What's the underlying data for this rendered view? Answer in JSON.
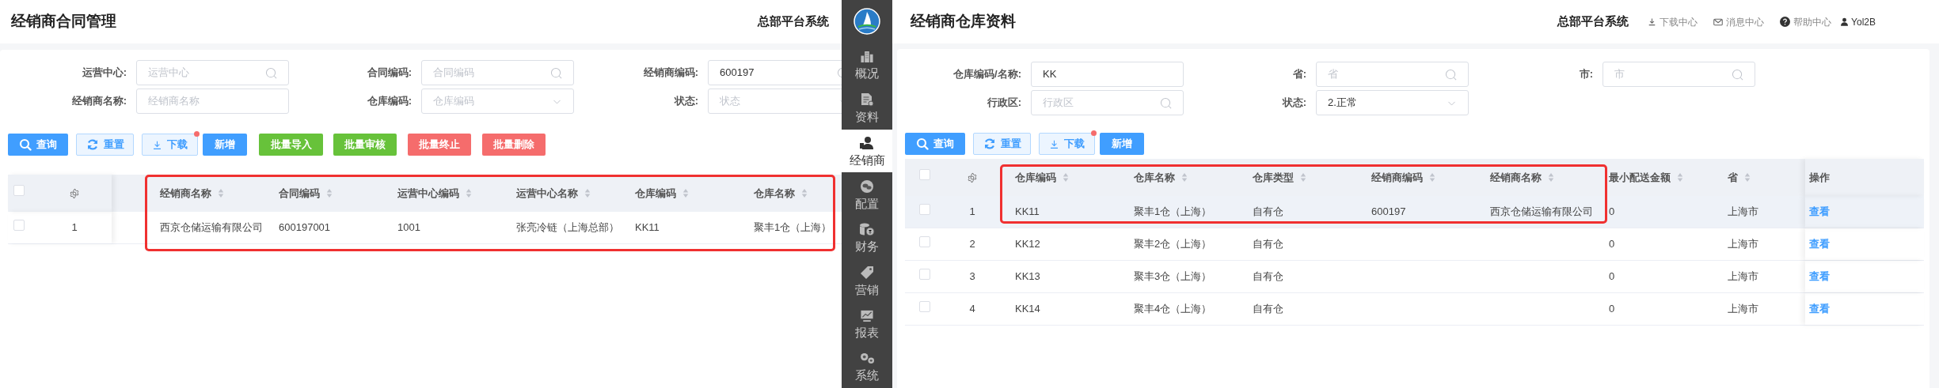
{
  "left_page": {
    "title": "经销商合同管理",
    "system_name": "总部平台系统",
    "filters": [
      {
        "label": "运营中心:",
        "placeholder": "运营中心",
        "kind": "search"
      },
      {
        "label": "合同编码:",
        "placeholder": "合同编码",
        "kind": "search"
      },
      {
        "label": "经销商编码:",
        "value": "600197",
        "kind": "search"
      },
      {
        "label": "经销商名称:",
        "placeholder": "经销商名称",
        "kind": "text"
      },
      {
        "label": "仓库编码:",
        "placeholder": "仓库编码",
        "kind": "select"
      },
      {
        "label": "状态:",
        "placeholder": "状态",
        "kind": "select"
      }
    ],
    "buttons": [
      {
        "label": "查询",
        "kind": "primary",
        "badge_dot": false
      },
      {
        "label": "重置",
        "kind": "outline",
        "badge_dot": false
      },
      {
        "label": "下载",
        "kind": "outline",
        "badge_dot": true
      },
      {
        "label": "新增",
        "kind": "primary",
        "badge_dot": false
      },
      {
        "label": "批量导入",
        "kind": "success",
        "badge_dot": false
      },
      {
        "label": "批量审核",
        "kind": "success",
        "badge_dot": false
      },
      {
        "label": "批量终止",
        "kind": "danger",
        "badge_dot": false
      },
      {
        "label": "批量删除",
        "kind": "danger",
        "badge_dot": false
      }
    ],
    "table": {
      "all_checked": false,
      "red_frame": true,
      "columns": [
        {
          "label": "经销商名称",
          "sortable": true
        },
        {
          "label": "合同编码",
          "sortable": true
        },
        {
          "label": "运营中心编码",
          "sortable": true
        },
        {
          "label": "运营中心名称",
          "sortable": true
        },
        {
          "label": "仓库编码",
          "sortable": true
        },
        {
          "label": "仓库名称",
          "sortable": true
        }
      ],
      "rows": [
        {
          "index": "1",
          "checked": false,
          "highlighted": false,
          "cells": [
            "西京仓储运输有限公司",
            "600197001",
            "1001",
            "张亮冷链（上海总部）",
            "KK11",
            "聚丰1仓（上海）"
          ]
        }
      ]
    }
  },
  "sidebar": {
    "items": [
      {
        "label": "概况",
        "selected": false
      },
      {
        "label": "资料",
        "selected": false
      },
      {
        "label": "经销商",
        "selected": true
      },
      {
        "label": "配置",
        "selected": false
      },
      {
        "label": "财务",
        "selected": false
      },
      {
        "label": "营销",
        "selected": false
      },
      {
        "label": "报表",
        "selected": false
      },
      {
        "label": "系统",
        "selected": false
      }
    ]
  },
  "right_page": {
    "title": "经销商仓库资料",
    "system_name": "总部平台系统",
    "header_links": [
      "下载中心",
      "消息中心",
      "帮助中心"
    ],
    "user": "Yol2B",
    "filters": [
      {
        "label": "仓库编码/名称:",
        "value": "KK",
        "kind": "text"
      },
      {
        "label": "省:",
        "placeholder": "省",
        "kind": "search"
      },
      {
        "label": "市:",
        "placeholder": "市",
        "kind": "search"
      },
      {
        "label": "行政区:",
        "placeholder": "行政区",
        "kind": "search"
      },
      {
        "label": "状态:",
        "value": "2.正常",
        "kind": "select"
      }
    ],
    "buttons": [
      {
        "label": "查询",
        "kind": "primary",
        "badge_dot": false
      },
      {
        "label": "重置",
        "kind": "outline",
        "badge_dot": false
      },
      {
        "label": "下载",
        "kind": "outline",
        "badge_dot": true
      },
      {
        "label": "新增",
        "kind": "primary",
        "badge_dot": false
      }
    ],
    "table": {
      "all_checked": false,
      "red_frame": true,
      "action_column": "操作",
      "columns": [
        {
          "label": "仓库编码",
          "sortable": true
        },
        {
          "label": "仓库名称",
          "sortable": true
        },
        {
          "label": "仓库类型",
          "sortable": true
        },
        {
          "label": "经销商编码",
          "sortable": true
        },
        {
          "label": "经销商名称",
          "sortable": true
        },
        {
          "label": "最小配送金额",
          "sortable": true
        },
        {
          "label": "省",
          "sortable": true
        }
      ],
      "rows": [
        {
          "index": "1",
          "checked": false,
          "highlighted": true,
          "cells": [
            "KK11",
            "聚丰1仓（上海）",
            "自有仓",
            "600197",
            "西京仓储运输有限公司",
            "0",
            "上海市"
          ],
          "action": "查看"
        },
        {
          "index": "2",
          "checked": false,
          "highlighted": false,
          "cells": [
            "KK12",
            "聚丰2仓（上海）",
            "自有仓",
            null,
            null,
            "0",
            "上海市"
          ],
          "action": "查看"
        },
        {
          "index": "3",
          "checked": false,
          "highlighted": false,
          "cells": [
            "KK13",
            "聚丰3仓（上海）",
            "自有仓",
            null,
            null,
            "0",
            "上海市"
          ],
          "action": "查看"
        },
        {
          "index": "4",
          "checked": false,
          "highlighted": false,
          "cells": [
            "KK14",
            "聚丰4仓（上海）",
            "自有仓",
            null,
            null,
            "0",
            "上海市"
          ],
          "action": "查看"
        }
      ]
    }
  }
}
